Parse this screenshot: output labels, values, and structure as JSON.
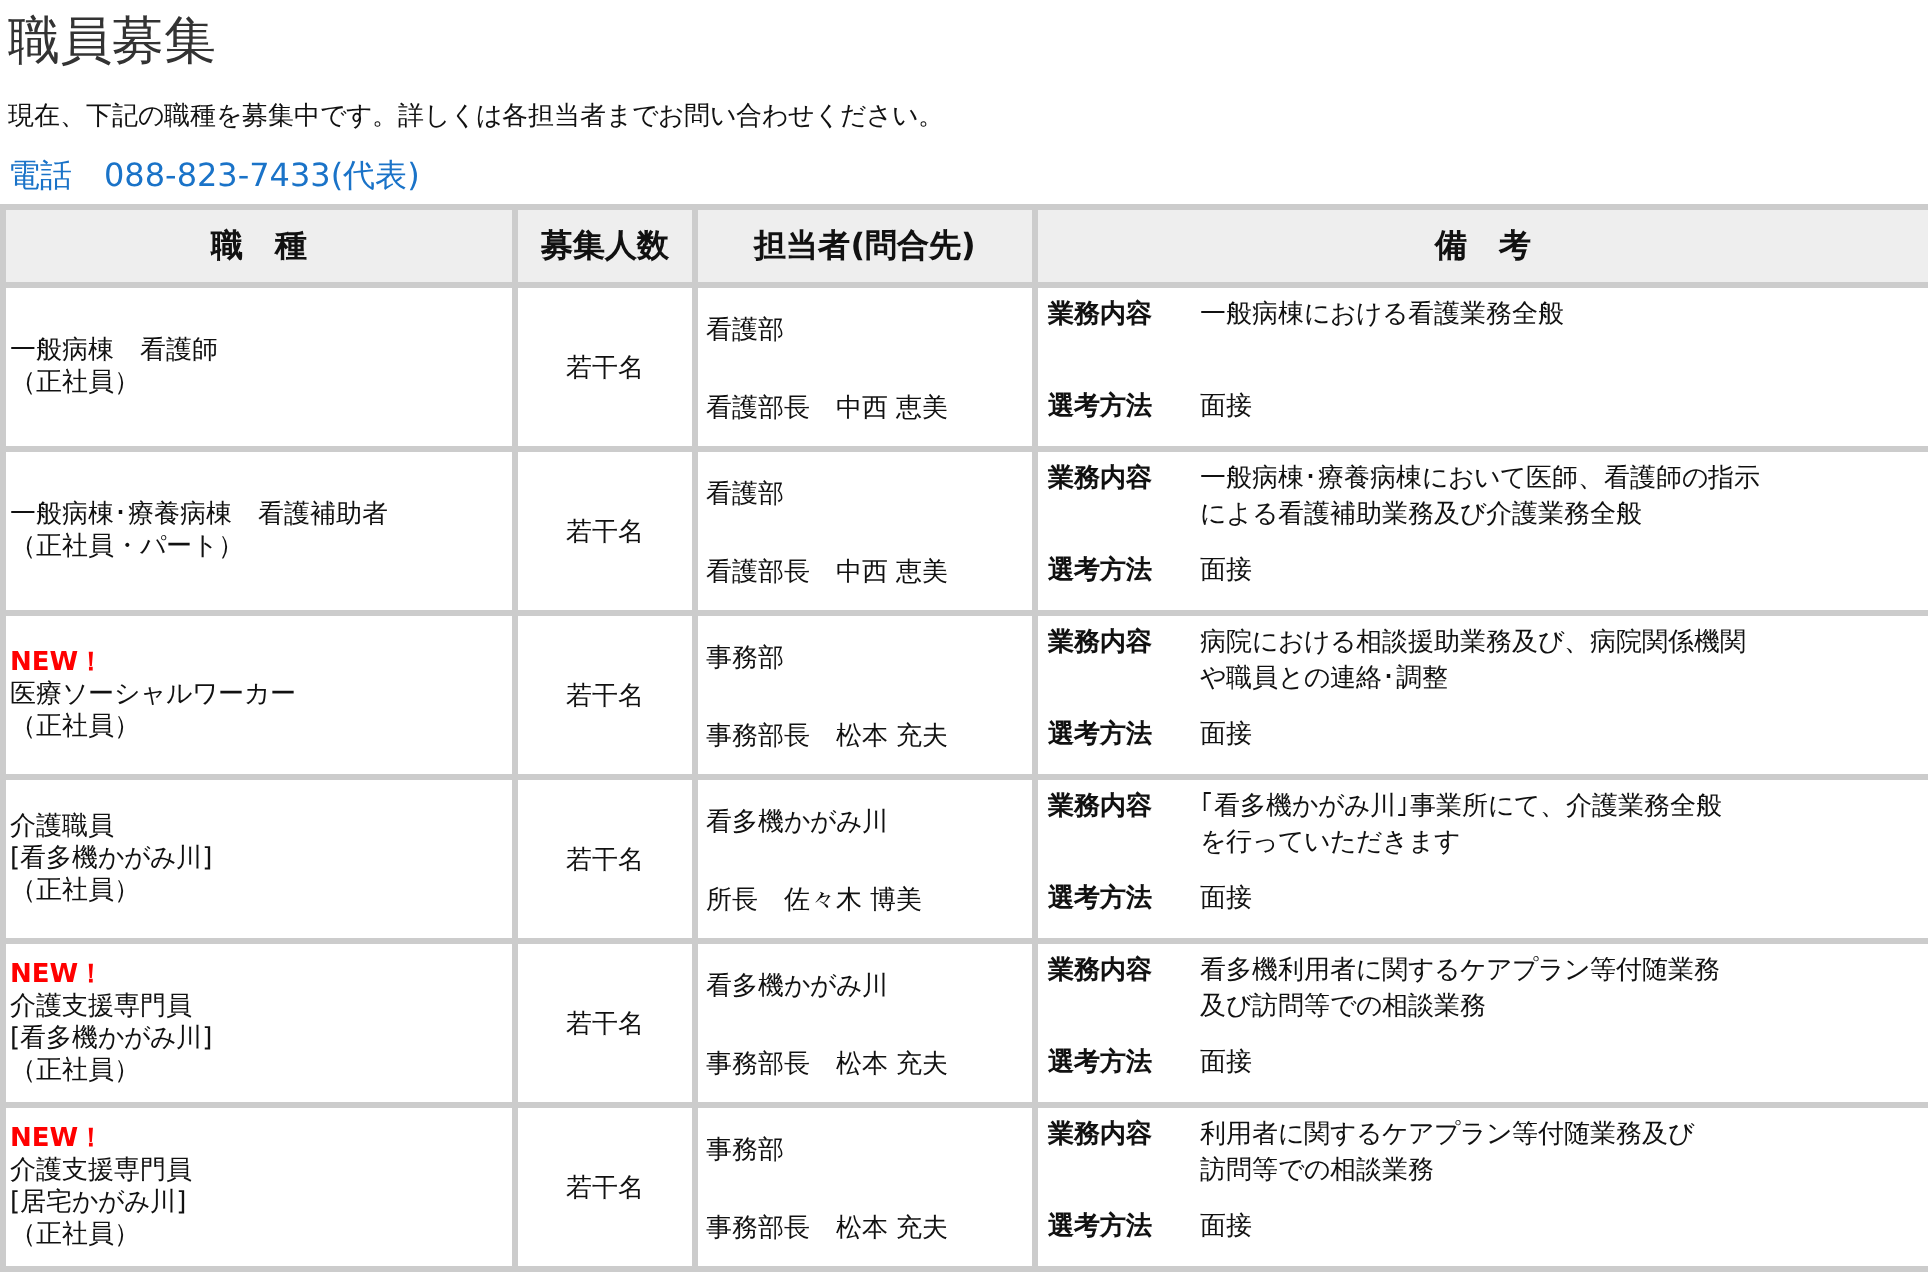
{
  "title": "職員募集",
  "intro": "現在、下記の職種を募集中です。詳しくは各担当者までお問い合わせください。",
  "phone": "電話　088-823-7433(代表)",
  "table": {
    "columns": [
      "職　種",
      "募集人数",
      "担当者(問合先)",
      "備　考"
    ],
    "rows": [
      {
        "job": [
          "一般病棟　看護師",
          "（正社員）"
        ],
        "count": "若干名",
        "department": "看護部",
        "person": "看護部長　中西 恵美",
        "duties_label": "業務内容",
        "duties": [
          "一般病棟における看護業務全般"
        ],
        "selection_label": "選考方法",
        "selection": "面接"
      },
      {
        "job": [
          "一般病棟･療養病棟　看護補助者",
          "（正社員・パート）"
        ],
        "count": "若干名",
        "department": "看護部",
        "person": "看護部長　中西 恵美",
        "duties_label": "業務内容",
        "duties": [
          "一般病棟･療養病棟において医師、看護師の指示",
          "による看護補助業務及び介護業務全般"
        ],
        "selection_label": "選考方法",
        "selection": "面接"
      },
      {
        "new_label": "NEW！",
        "job": [
          "医療ソーシャルワーカー",
          "（正社員）"
        ],
        "count": "若干名",
        "department": "事務部",
        "person": "事務部長　松本 充夫",
        "duties_label": "業務内容",
        "duties": [
          "病院における相談援助業務及び、病院関係機関",
          "や職員との連絡･調整"
        ],
        "selection_label": "選考方法",
        "selection": "面接"
      },
      {
        "job": [
          "介護職員",
          "[看多機かがみ川]",
          "（正社員）"
        ],
        "count": "若干名",
        "department": "看多機かがみ川",
        "person": "所長　佐々木 博美",
        "duties_label": "業務内容",
        "duties": [
          "｢看多機かがみ川｣事業所にて、介護業務全般",
          "を行っていただきます"
        ],
        "selection_label": "選考方法",
        "selection": "面接"
      },
      {
        "new_label": "NEW！",
        "job": [
          "介護支援専門員",
          "[看多機かがみ川]",
          "（正社員）"
        ],
        "count": "若干名",
        "department": "看多機かがみ川",
        "person": "事務部長　松本 充夫",
        "duties_label": "業務内容",
        "duties": [
          "看多機利用者に関するケアプラン等付随業務",
          "及び訪問等での相談業務"
        ],
        "selection_label": "選考方法",
        "selection": "面接"
      },
      {
        "new_label": "NEW！",
        "job": [
          "介護支援専門員",
          "[居宅かがみ川]",
          "（正社員）"
        ],
        "count": "若干名",
        "department": "事務部",
        "person": "事務部長　松本 充夫",
        "duties_label": "業務内容",
        "duties": [
          "利用者に関するケアプラン等付随業務及び",
          "訪問等での相談業務"
        ],
        "selection_label": "選考方法",
        "selection": "面接"
      }
    ]
  }
}
